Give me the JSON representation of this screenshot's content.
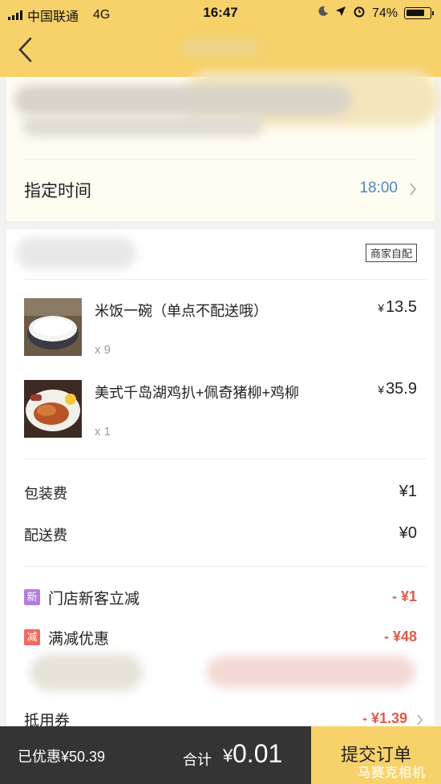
{
  "status_bar": {
    "carrier": "中国联通",
    "network": "4G",
    "time": "16:47",
    "battery": "74%"
  },
  "delivery": {
    "time_label": "指定时间",
    "time_value": "18:00"
  },
  "order": {
    "store_tag": "商家自配",
    "items": [
      {
        "name": "米饭一碗（单点不配送哦）",
        "qty": "x 9",
        "price": "13.5"
      },
      {
        "name": "美式千岛湖鸡扒+佩奇猪柳+鸡柳",
        "qty": "x 1",
        "price": "35.9"
      }
    ],
    "currency": "¥",
    "fees": [
      {
        "label": "包装费",
        "amount": "¥1"
      },
      {
        "label": "配送费",
        "amount": "¥0"
      }
    ],
    "promos": [
      {
        "badge": "新",
        "badge_color": "#b37ee0",
        "label": "门店新客立减",
        "amount": "- ¥1"
      },
      {
        "badge": "减",
        "badge_color": "#ef6a5d",
        "label": "满减优惠",
        "amount": "- ¥48"
      }
    ],
    "coupon": {
      "label": "抵用券",
      "amount": "- ¥1.39"
    }
  },
  "bottom_bar": {
    "saved": "已优惠¥50.39",
    "total_label": "合计",
    "total_currency": "¥",
    "total_value": "0.01",
    "submit_label": "提交订单"
  },
  "watermark": "马赛克相机",
  "colors": {
    "header": "#f7d169",
    "accent_blue": "#4a86c8",
    "discount_red": "#e05a4a",
    "bottom_bar": "#343434"
  }
}
